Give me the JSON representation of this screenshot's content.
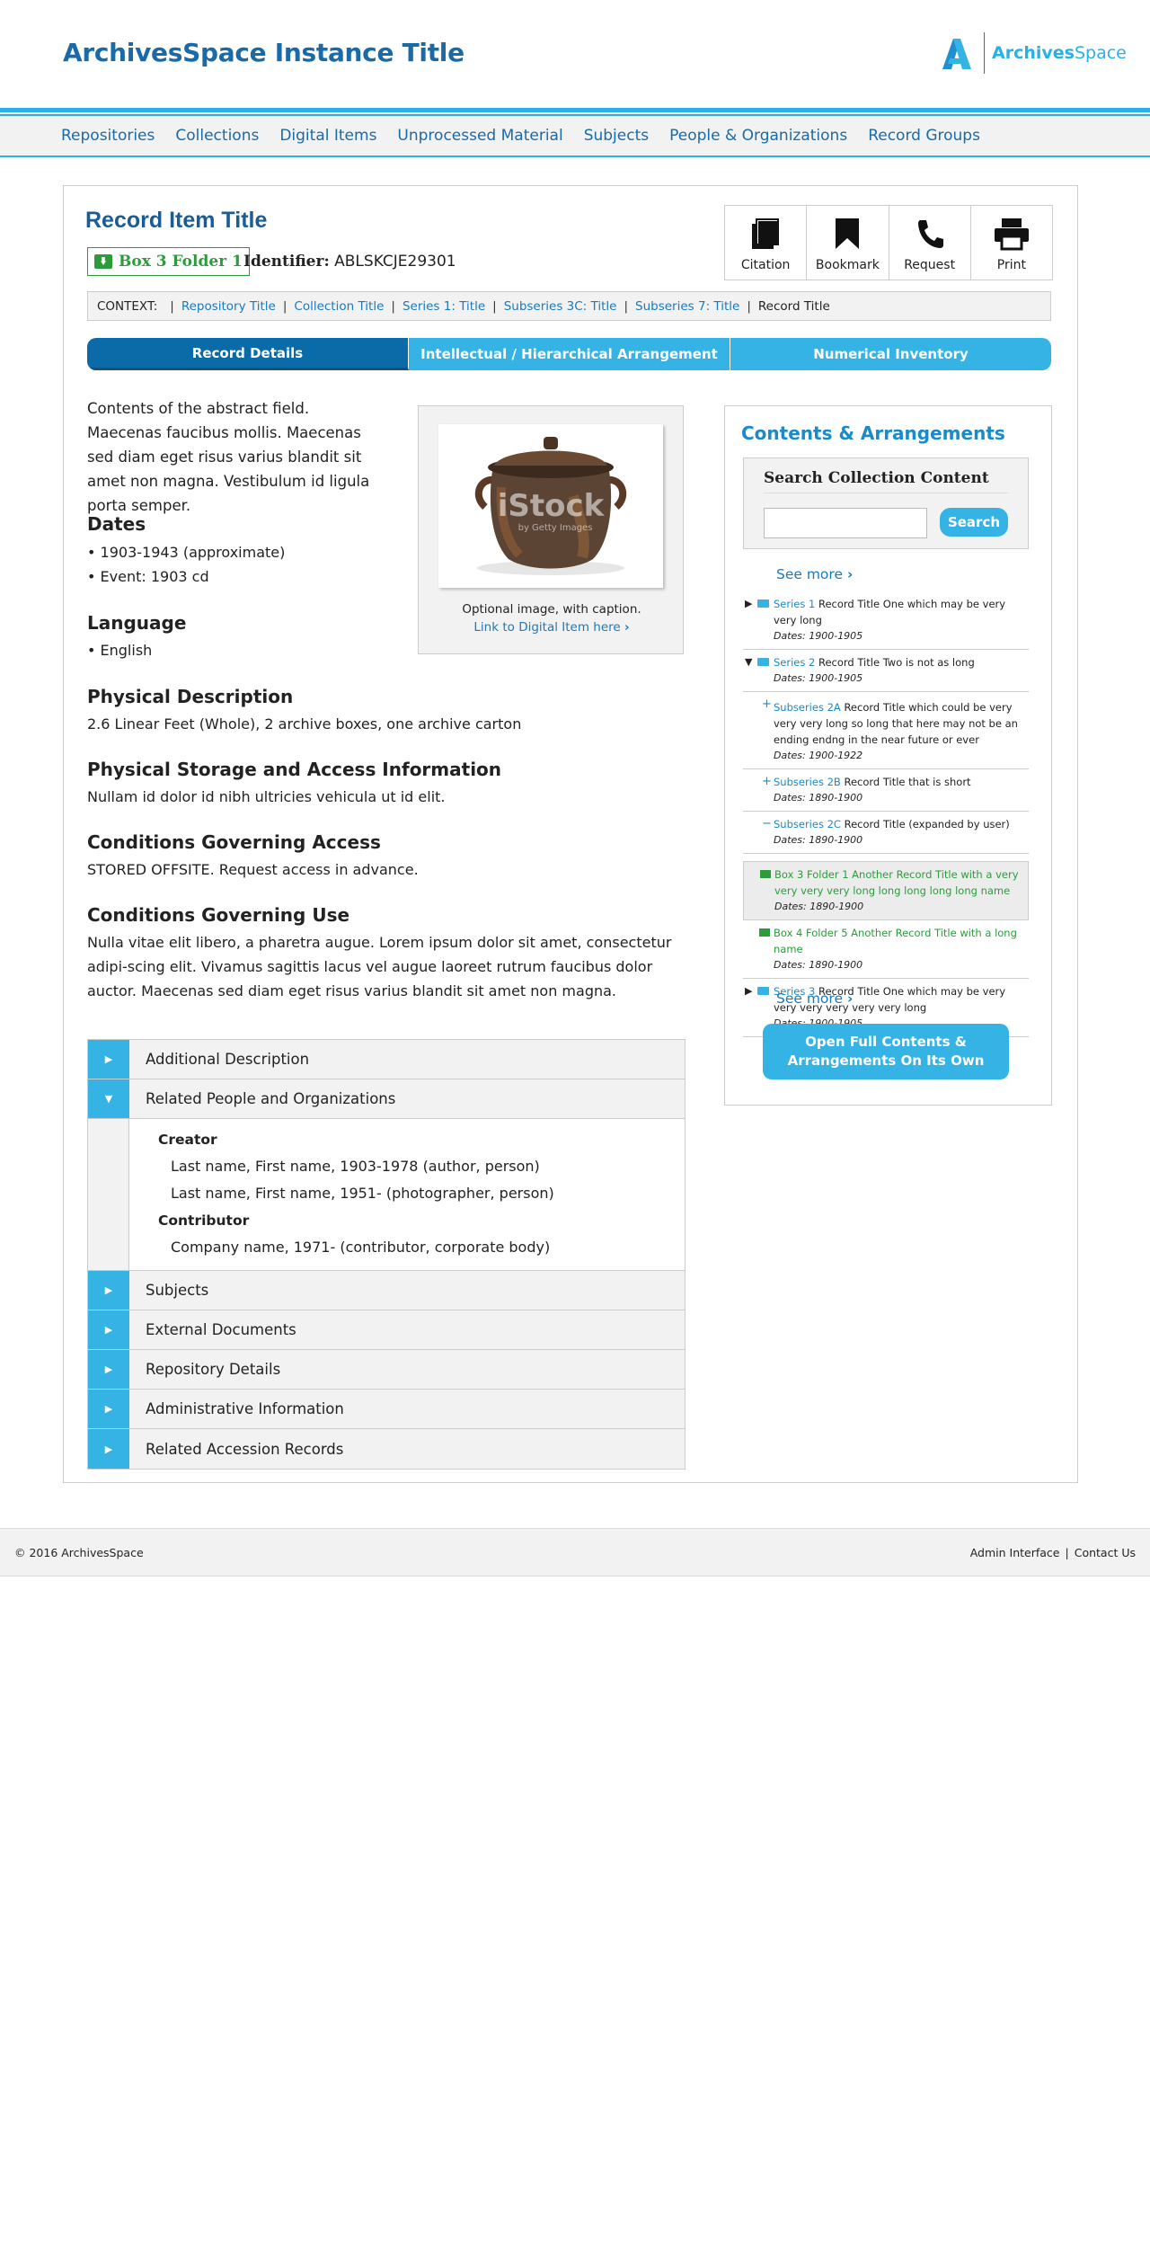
{
  "header": {
    "site_title": "ArchivesSpace Instance Title",
    "logo_text_bold": "Archives",
    "logo_text_thin": "Space"
  },
  "nav": {
    "items": [
      {
        "label": "Repositories"
      },
      {
        "label": "Collections"
      },
      {
        "label": "Digital Items"
      },
      {
        "label": "Unprocessed Material"
      },
      {
        "label": "Subjects"
      },
      {
        "label": "People & Organizations"
      },
      {
        "label": "Record Groups"
      }
    ]
  },
  "record": {
    "title": "Record Item Title",
    "container": "Box 3 Folder 1",
    "identifier_label": "Identifier:",
    "identifier_value": "ABLSKCJE29301"
  },
  "actions": {
    "citation": "Citation",
    "bookmark": "Bookmark",
    "request": "Request",
    "print": "Print"
  },
  "context": {
    "label": "CONTEXT:",
    "links": [
      "Repository Title",
      "Collection Title",
      "Series 1: Title",
      "Subseries 3C: Title",
      "Subseries 7: Title"
    ],
    "current": "Record Title"
  },
  "tabs": [
    {
      "label": "Record Details",
      "active": true
    },
    {
      "label": "Intellectual / Hierarchical Arrangement",
      "active": false
    },
    {
      "label": "Numerical Inventory",
      "active": false
    }
  ],
  "abstract": "Contents of the abstract field. Maecenas faucibus mollis. Maecenas sed diam eget risus varius blandit sit amet non magna. Vestibulum id ligula porta semper.",
  "image": {
    "caption": "Optional image, with caption.",
    "link": "Link to Digital Item here",
    "watermark": "iStock",
    "watermark_sub": "by Getty Images"
  },
  "sections": {
    "dates_h": "Dates",
    "dates_1": "• 1903-1943 (approximate)",
    "dates_2": "• Event: 1903 cd",
    "language_h": "Language",
    "language_1": "• English",
    "physdesc_h": "Physical Description",
    "physdesc_t": "2.6 Linear Feet (Whole), 2 archive boxes, one archive carton",
    "storage_h": "Physical Storage and Access Information",
    "storage_t": "Nullam id dolor id nibh ultricies vehicula ut id elit.",
    "access_h": "Conditions Governing Access",
    "access_t": "STORED OFFSITE. Request access in advance.",
    "use_h": "Conditions Governing Use",
    "use_t": "Nulla vitae elit libero, a pharetra augue. Lorem ipsum dolor sit amet, consectetur adipi-scing elit. Vivamus sagittis lacus vel augue laoreet rutrum faucibus dolor auctor. Maecenas sed diam eget risus varius blandit sit amet non magna."
  },
  "accordion": {
    "additional": "Additional Description",
    "related": "Related People and Organizations",
    "creator_role": "Creator",
    "creator_1": "Last name, First name, 1903-1978 (author, person)",
    "creator_2": "Last name, First name, 1951- (photographer, person)",
    "contrib_role": "Contributor",
    "contrib_1": "Company name, 1971- (contributor, corporate body)",
    "subjects": "Subjects",
    "external": "External Documents",
    "repository": "Repository Details",
    "admin": "Administrative Information",
    "accessions": "Related Accession Records"
  },
  "sidebar": {
    "title": "Contents & Arrangements",
    "search_heading": "Search Collection Content",
    "search_button": "Search",
    "see_more": "See more",
    "open_button": "Open Full Contents & Arrangements On Its Own",
    "tree": [
      {
        "link": "Series 1",
        "text": " Record Title One which may be very very long",
        "date": "Dates: 1900-1905"
      },
      {
        "link": "Series 2",
        "text": " Record Title Two is not as long",
        "date": "Dates: 1900-1905"
      },
      {
        "link": "Subseries 2A",
        "text": " Record Title which could be very very very long so long that here may not be an ending endng in the near future or ever",
        "date": "Dates: 1900-1922"
      },
      {
        "link": "Subseries 2B",
        "text": " Record Title that is short",
        "date": "Dates: 1890-1900"
      },
      {
        "link": "Subseries 2C",
        "text": " Record Title (expanded by user)",
        "date": "Dates: 1890-1900"
      },
      {
        "link": "Box 3 Folder 1",
        "text": " Another Record Title with a very very very very long long long long long name",
        "date": "Dates: 1890-1900"
      },
      {
        "link": "Box 4 Folder 5",
        "text": " Another Record Title with a long name",
        "date": "Dates: 1890-1900"
      },
      {
        "link": "Series 3",
        "text": " Record Title One which may be very very very very very very long",
        "date": "Dates: 1900-1905"
      }
    ]
  },
  "footer": {
    "copyright": "© 2016 ArchivesSpace",
    "admin": "Admin Interface",
    "contact": "Contact Us"
  },
  "colors": {
    "brand_blue": "#1a6aa8",
    "accent_blue": "#35b3e4",
    "green": "#2a9d3a"
  }
}
